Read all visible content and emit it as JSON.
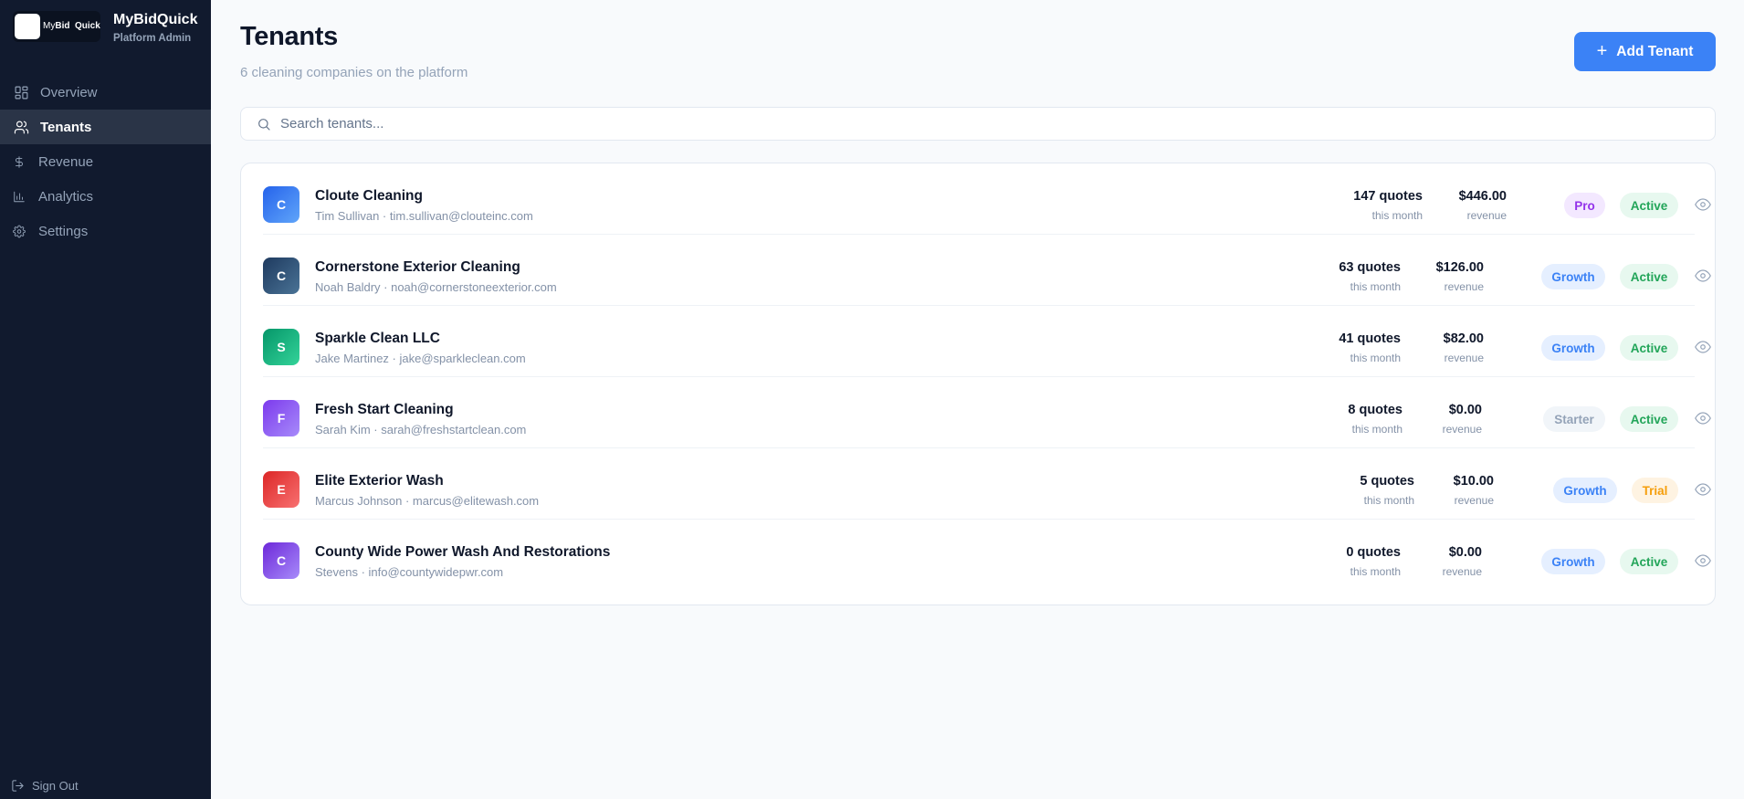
{
  "brand": {
    "name": "MyBidQuick",
    "subtitle": "Platform Admin",
    "logo_text_a": "My",
    "logo_text_b": "Bid",
    "logo_text_c": "Quick"
  },
  "sidebar": {
    "items": [
      {
        "label": "Overview",
        "icon": "grid-icon",
        "active": false
      },
      {
        "label": "Tenants",
        "icon": "users-icon",
        "active": true
      },
      {
        "label": "Revenue",
        "icon": "dollar-icon",
        "active": false
      },
      {
        "label": "Analytics",
        "icon": "bar-chart-icon",
        "active": false
      },
      {
        "label": "Settings",
        "icon": "gear-icon",
        "active": false
      }
    ],
    "sign_out": "Sign Out"
  },
  "header": {
    "title": "Tenants",
    "subtitle": "6 cleaning companies on the platform",
    "add_button": "Add Tenant"
  },
  "search": {
    "placeholder": "Search tenants..."
  },
  "colors": {
    "accent": "#3b82f6",
    "sidebar_bg": "#111a2e"
  },
  "tenants": [
    {
      "initial": "C",
      "name": "Cloute Cleaning",
      "contact": "Tim Sullivan · tim.sullivan@clouteinc.com",
      "quotes": "147 quotes",
      "quotes_label": "this month",
      "revenue": "$446.00",
      "revenue_label": "revenue",
      "plan": "Pro",
      "status": "Active",
      "avatar_color": "#3b82f6"
    },
    {
      "initial": "C",
      "name": "Cornerstone Exterior Cleaning",
      "contact": "Noah Baldry · noah@cornerstoneexterior.com",
      "quotes": "63 quotes",
      "quotes_label": "this month",
      "revenue": "$126.00",
      "revenue_label": "revenue",
      "plan": "Growth",
      "status": "Active",
      "avatar_color": "#1e3a5f"
    },
    {
      "initial": "S",
      "name": "Sparkle Clean LLC",
      "contact": "Jake Martinez · jake@sparkleclean.com",
      "quotes": "41 quotes",
      "quotes_label": "this month",
      "revenue": "$82.00",
      "revenue_label": "revenue",
      "plan": "Growth",
      "status": "Active",
      "avatar_color": "#10b981"
    },
    {
      "initial": "F",
      "name": "Fresh Start Cleaning",
      "contact": "Sarah Kim · sarah@freshstartclean.com",
      "quotes": "8 quotes",
      "quotes_label": "this month",
      "revenue": "$0.00",
      "revenue_label": "revenue",
      "plan": "Starter",
      "status": "Active",
      "avatar_color": "#8b5cf6"
    },
    {
      "initial": "E",
      "name": "Elite Exterior Wash",
      "contact": "Marcus Johnson · marcus@elitewash.com",
      "quotes": "5 quotes",
      "quotes_label": "this month",
      "revenue": "$10.00",
      "revenue_label": "revenue",
      "plan": "Growth",
      "status": "Trial",
      "avatar_color": "#ef4444"
    },
    {
      "initial": "C",
      "name": "County Wide Power Wash And Restorations",
      "contact": "Stevens · info@countywidepwr.com",
      "quotes": "0 quotes",
      "quotes_label": "this month",
      "revenue": "$0.00",
      "revenue_label": "revenue",
      "plan": "Growth",
      "status": "Active",
      "avatar_color": "#7c3aed"
    }
  ]
}
